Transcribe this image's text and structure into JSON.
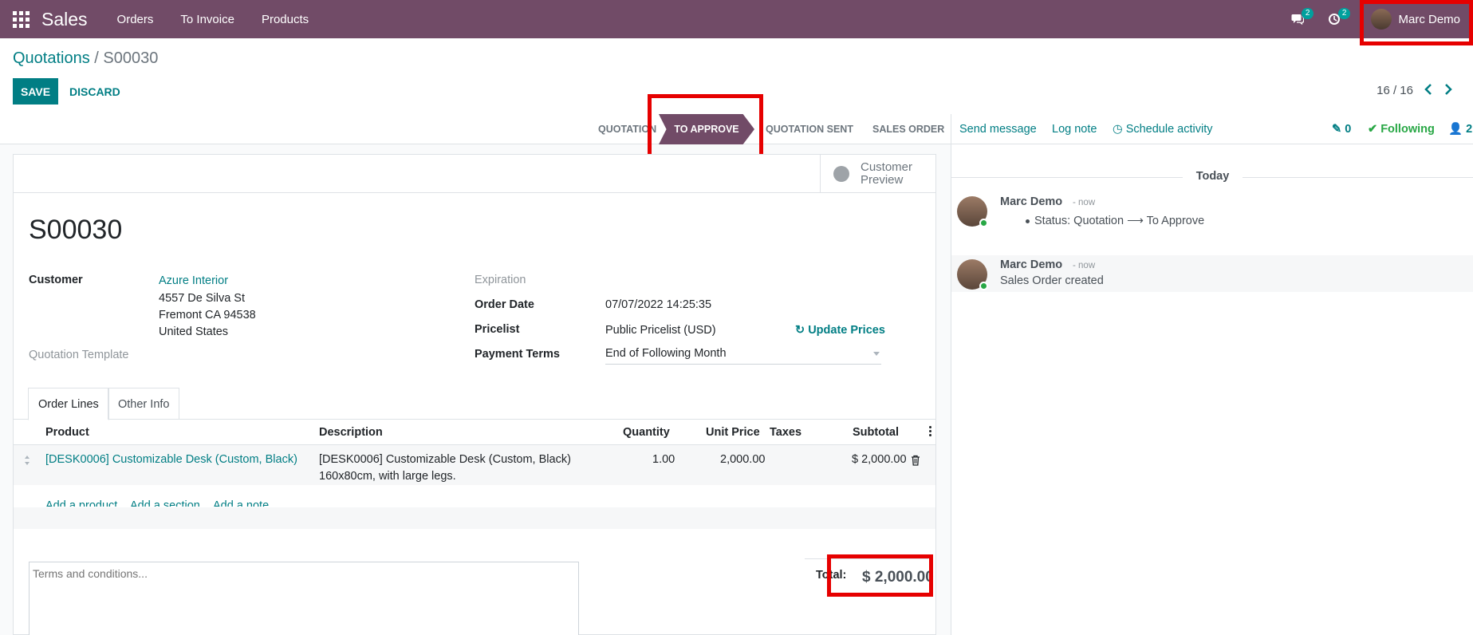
{
  "navbar": {
    "app_name": "Sales",
    "menu": [
      "Orders",
      "To Invoice",
      "Products"
    ],
    "messages_badge": "2",
    "activities_badge": "2",
    "user_name": "Marc Demo"
  },
  "breadcrumb": {
    "parent": "Quotations",
    "separator": "/",
    "current": "S00030"
  },
  "actions": {
    "save_label": "SAVE",
    "discard_label": "DISCARD"
  },
  "pager": {
    "value": "16 / 16",
    "prev_icon": "chevron-left-icon",
    "next_icon": "chevron-right-icon"
  },
  "statusbar": {
    "stages": [
      "QUOTATION",
      "TO APPROVE",
      "QUOTATION SENT",
      "SALES ORDER"
    ],
    "active": "TO APPROVE"
  },
  "smart_buttons": {
    "preview_line1": "Customer",
    "preview_line2": "Preview"
  },
  "order": {
    "name": "S00030",
    "customer_label": "Customer",
    "customer_name": "Azure Interior",
    "address_line1": "4557 De Silva St",
    "address_line2": "Fremont CA 94538",
    "address_line3": "United States",
    "template_label": "Quotation Template",
    "expiration_label": "Expiration",
    "order_date_label": "Order Date",
    "order_date": "07/07/2022 14:25:35",
    "pricelist_label": "Pricelist",
    "pricelist": "Public Pricelist (USD)",
    "update_prices": "Update Prices",
    "payment_terms_label": "Payment Terms",
    "payment_terms": "End of Following Month"
  },
  "tabs": [
    "Order Lines",
    "Other Info"
  ],
  "table": {
    "columns": [
      "Product",
      "Description",
      "Quantity",
      "Unit Price",
      "Taxes",
      "Subtotal"
    ],
    "rows": [
      {
        "product": "[DESK0006] Customizable Desk (Custom, Black)",
        "description_line1": "[DESK0006] Customizable Desk (Custom, Black)",
        "description_line2": "160x80cm, with large legs.",
        "quantity": "1.00",
        "unit_price": "2,000.00",
        "taxes": "",
        "subtotal": "$ 2,000.00"
      }
    ],
    "add_product": "Add a product",
    "add_section": "Add a section",
    "add_note": "Add a note"
  },
  "footer": {
    "terms_placeholder": "Terms and conditions...",
    "total_label": "Total:",
    "total_value": "$ 2,000.00"
  },
  "chatter": {
    "send_message": "Send message",
    "log_note": "Log note",
    "schedule_activity": "Schedule activity",
    "attachments_count": "0",
    "following": "Following",
    "followers_count": "2",
    "date_separator": "Today",
    "messages": [
      {
        "author": "Marc Demo",
        "date": "- now",
        "body": "Status: Quotation ⟶ To Approve"
      },
      {
        "author": "Marc Demo",
        "date": "- now",
        "body": "Sales Order created"
      }
    ]
  },
  "colors": {
    "brand": "#714B67",
    "accent": "#017e84",
    "highlight": "#e60000",
    "following": "#28a745"
  }
}
